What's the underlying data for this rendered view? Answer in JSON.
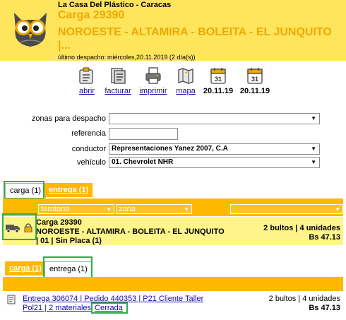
{
  "header": {
    "company": "La Casa Del Plástico - Caracas",
    "carga_title": "Carga 29390",
    "route": "NOROESTE - ALTAMIRA - BOLEITA - EL JUNQUITO |...",
    "last_dispatch_label": "último despacho:",
    "last_dispatch_value": "miércoles,20.11.2019 (2 día(s))"
  },
  "toolbar": {
    "abrir": "abrir",
    "facturar": "facturar",
    "imprimir": "imprimir",
    "mapa": "mapa",
    "date1": "20.11.19",
    "date2": "20.11.19",
    "cal_day": "31"
  },
  "form": {
    "zonas_label": "zonas para despacho",
    "zonas_value": "",
    "referencia_label": "referencia",
    "referencia_value": "",
    "conductor_label": "conductor",
    "conductor_value": "Representaciones Yanez 2007, C.A",
    "vehiculo_label": "vehículo",
    "vehiculo_value": "01. Chevrolet NHR"
  },
  "tabs1": {
    "carga": "carga (1)",
    "entrega": "entrega (1)"
  },
  "table1": {
    "col_territorio": "territorio",
    "col_zona": "zona",
    "row": {
      "line1": "Carga 29390",
      "line2": "NOROESTE - ALTAMIRA - BOLEITA - EL JUNQUITO",
      "line3": "| 01 | Sin Placa (1)",
      "qty": "2 bultos | 4 unidades",
      "amount": "Bs 47.13"
    }
  },
  "tabs2": {
    "carga": "carga (1)",
    "entrega": "entrega (1)"
  },
  "table2": {
    "row": {
      "line1": "Entrega 306074 | Pedido 440353 | P21 Cliente Taller",
      "line2": "Pol21 | 2 materiales",
      "status": "Cerrada",
      "qty": "2 bultos | 4 unidades",
      "amount": "Bs 47.13"
    }
  },
  "colors": {
    "header_bg": "#ffe55c",
    "title": "#f0a800",
    "tab_orange": "#ffb800",
    "row_bg": "#fff58a",
    "link": "#1a0aa8",
    "highlight": "#2eae4a"
  }
}
